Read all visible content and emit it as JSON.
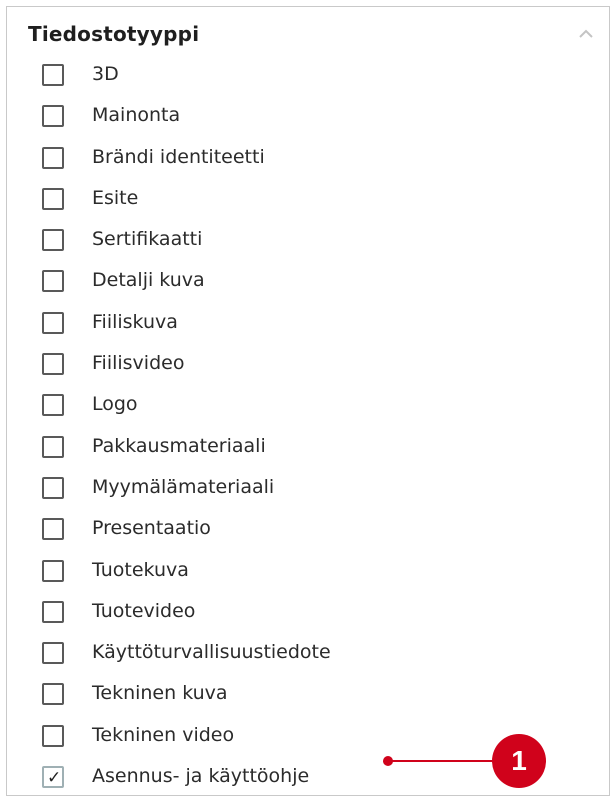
{
  "filter": {
    "title": "Tiedostotyyppi",
    "collapse_icon": "chevron-up-icon",
    "items": [
      {
        "label": "3D",
        "checked": false
      },
      {
        "label": "Mainonta",
        "checked": false
      },
      {
        "label": "Brändi identiteetti",
        "checked": false
      },
      {
        "label": "Esite",
        "checked": false
      },
      {
        "label": "Sertifikaatti",
        "checked": false
      },
      {
        "label": "Detalji kuva",
        "checked": false
      },
      {
        "label": "Fiiliskuva",
        "checked": false
      },
      {
        "label": "Fiilisvideo",
        "checked": false
      },
      {
        "label": "Logo",
        "checked": false
      },
      {
        "label": "Pakkausmateriaali",
        "checked": false
      },
      {
        "label": "Myymälämateriaali",
        "checked": false
      },
      {
        "label": "Presentaatio",
        "checked": false
      },
      {
        "label": "Tuotekuva",
        "checked": false
      },
      {
        "label": "Tuotevideo",
        "checked": false
      },
      {
        "label": "Käyttöturvallisuustiedote",
        "checked": false
      },
      {
        "label": "Tekninen kuva",
        "checked": false
      },
      {
        "label": "Tekninen video",
        "checked": false
      },
      {
        "label": "Asennus- ja käyttöohje",
        "checked": true
      }
    ]
  },
  "callout": {
    "number": "1",
    "color": "#d0021b"
  },
  "check_glyph": "✓"
}
